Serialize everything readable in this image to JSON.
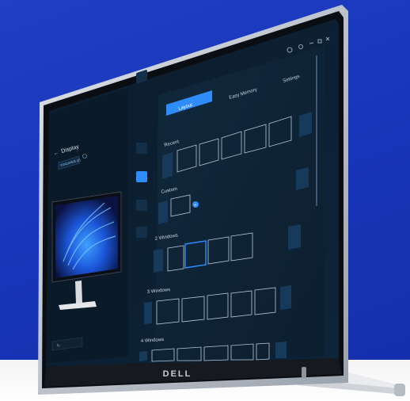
{
  "product": {
    "brand_logo": "DELL",
    "brand_logo_icon": "dell-logo"
  },
  "app": {
    "window_controls": {
      "icons": [
        "gear-icon",
        "settings-icon",
        "minimize-icon",
        "maximize-icon",
        "close-icon"
      ]
    },
    "sidebar": {
      "back_icon": "arrow-left-icon",
      "title": "Display",
      "selector_value": "P2424HEB (2)",
      "selector_icon": "chevron-down-icon",
      "info_icon": "info-icon",
      "reset_icon": "refresh-icon",
      "monitor_preview_icon": "monitor-preview"
    },
    "nav_rail": {
      "items": [
        "monitor-icon",
        "input-icon",
        "layout-icon",
        "pip-icon",
        "display-icon"
      ],
      "active_index": 2
    },
    "tabs": [
      {
        "label": "Layout",
        "active": true
      },
      {
        "label": "Easy Memory",
        "active": false
      },
      {
        "label": "Settings",
        "active": false
      }
    ],
    "sections": [
      {
        "title": "Recent"
      },
      {
        "title": "Custom",
        "add_icon": "plus-icon"
      },
      {
        "title": "2 Windows"
      },
      {
        "title": "3 Windows"
      },
      {
        "title": "4 Windows"
      }
    ],
    "nav_arrows": {
      "left_icon": "arrow-left-icon",
      "right_icon": "arrow-right-icon"
    },
    "accent_color": "#2f8cff"
  }
}
